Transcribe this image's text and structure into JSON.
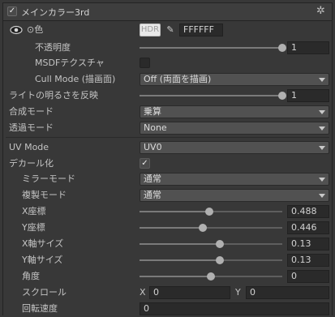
{
  "header": {
    "title": "メインカラー3rd",
    "enabled": true
  },
  "color": {
    "label": "⊙色",
    "hdr_label": "HDR",
    "hex": "FFFFFF"
  },
  "opacity": {
    "label": "不透明度",
    "value": "1",
    "level": 1.0
  },
  "msdf": {
    "label": "MSDFテクスチャ",
    "checked": false
  },
  "cull": {
    "label": "Cull Mode (描画面)",
    "value": "Off (両面を描画)"
  },
  "light": {
    "label": "ライトの明るさを反映",
    "value": "1",
    "level": 1.0
  },
  "blend": {
    "label": "合成モード",
    "value": "乗算"
  },
  "transparency": {
    "label": "透過モード",
    "value": "None"
  },
  "uv": {
    "label": "UV Mode",
    "value": "UV0"
  },
  "decal": {
    "label": "デカール化",
    "checked": true
  },
  "mirror": {
    "label": "ミラーモード",
    "value": "通常"
  },
  "copy": {
    "label": "複製モード",
    "value": "通常"
  },
  "xpos": {
    "label": "X座標",
    "value": "0.488",
    "level": 0.488
  },
  "ypos": {
    "label": "Y座標",
    "value": "0.446",
    "level": 0.446
  },
  "xsize": {
    "label": "X軸サイズ",
    "value": "0.13",
    "level": 0.565
  },
  "ysize": {
    "label": "Y軸サイズ",
    "value": "0.13",
    "level": 0.565
  },
  "angle": {
    "label": "角度",
    "value": "0",
    "level": 0.5
  },
  "scroll": {
    "label": "スクロール",
    "x_label": "X",
    "x_value": "0",
    "y_label": "Y",
    "y_value": "0"
  },
  "rotspeed": {
    "label": "回転速度",
    "value": "0"
  }
}
